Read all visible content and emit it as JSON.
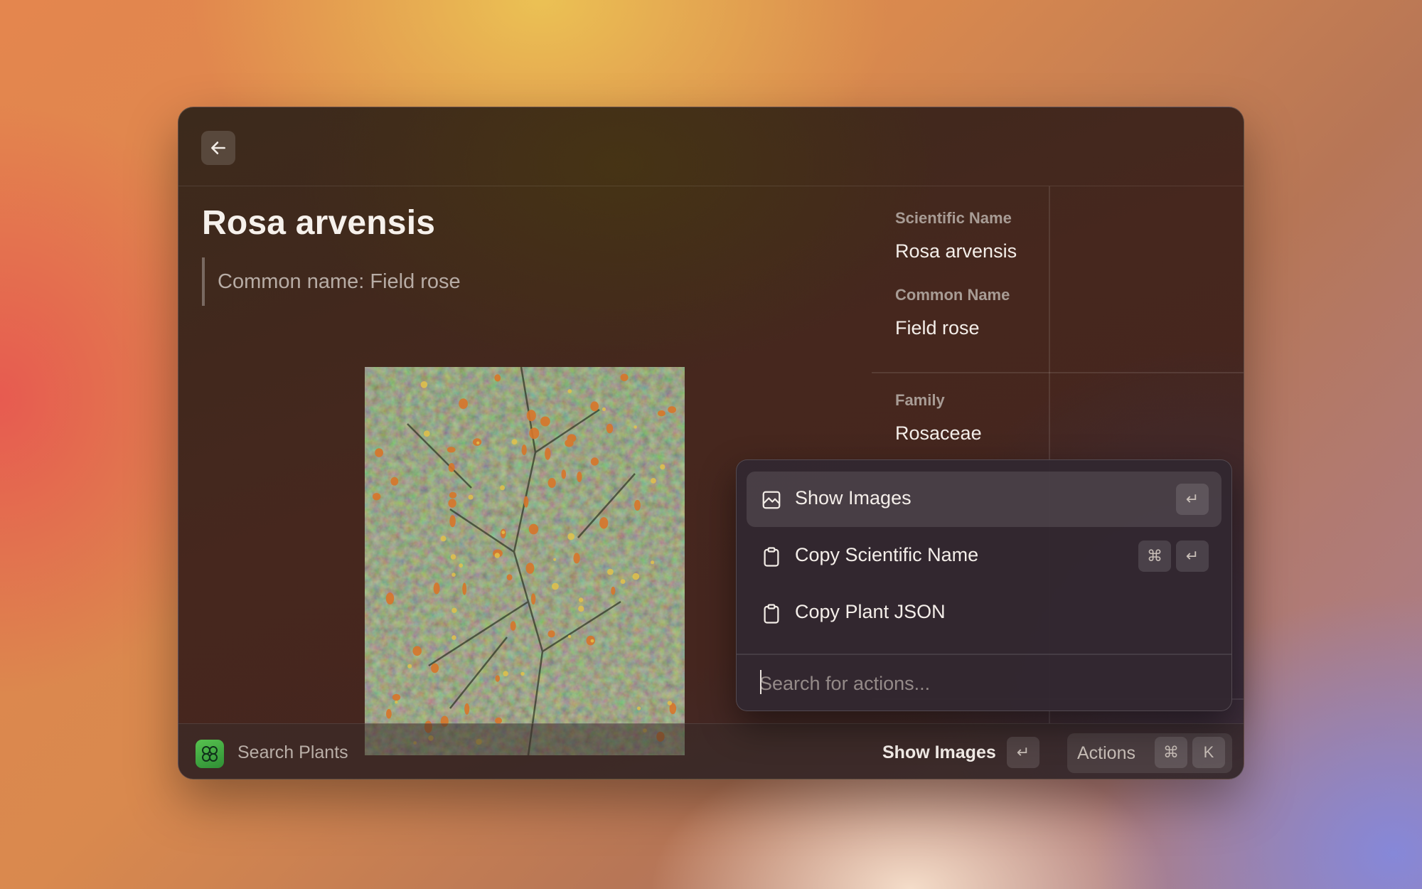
{
  "window": {
    "back_icon": "arrow-left-icon"
  },
  "detail": {
    "title": "Rosa arvensis",
    "quote": "Common name: Field rose",
    "image_alt": "photo-of-field-rose-shrub"
  },
  "metadata": {
    "items": [
      {
        "label": "Scientific Name",
        "value": "Rosa arvensis"
      },
      {
        "label": "Common Name",
        "value": "Field rose"
      },
      {
        "label": "Family",
        "value": "Rosaceae"
      }
    ]
  },
  "bottom_bar": {
    "app_name": "Search Plants",
    "app_icon": "clover-icon",
    "primary_action": "Show Images",
    "primary_key": "↵",
    "actions_label": "Actions",
    "actions_keys": [
      "⌘",
      "K"
    ]
  },
  "action_panel": {
    "items": [
      {
        "label": "Show Images",
        "icon": "image-icon",
        "shortcut": [
          "↵"
        ],
        "selected": true
      },
      {
        "label": "Copy Scientific Name",
        "icon": "clipboard-icon",
        "shortcut": [
          "⌘",
          "↵"
        ],
        "selected": false
      },
      {
        "label": "Copy Plant JSON",
        "icon": "clipboard-icon",
        "shortcut": [],
        "selected": false
      }
    ],
    "search_placeholder": "Search for actions..."
  },
  "colors": {
    "app_icon_green": "#3fa83f",
    "text_primary": "#f4eee9",
    "text_secondary": "#a89c95"
  }
}
